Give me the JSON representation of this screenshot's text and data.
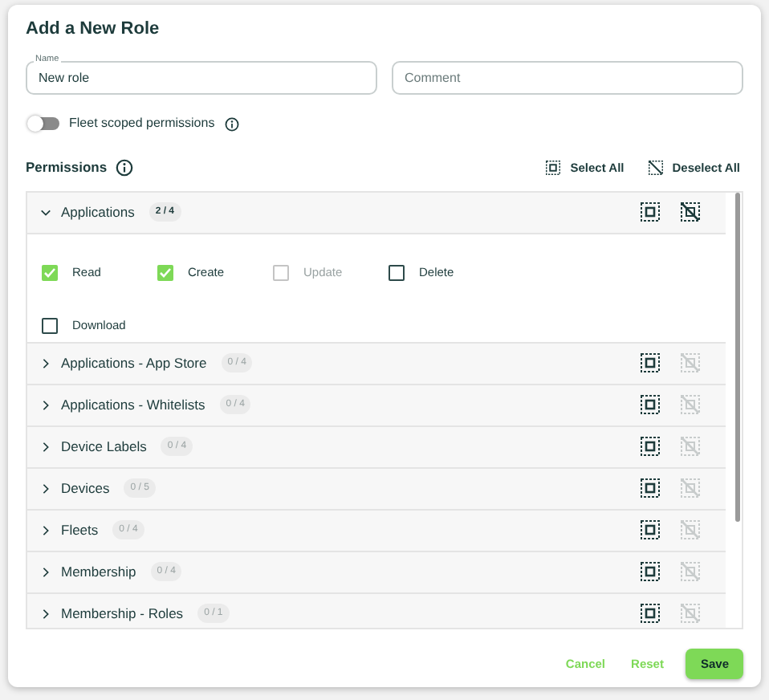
{
  "dialog": {
    "title": "Add a New Role"
  },
  "fields": [
    {
      "label": "Name",
      "value": "New role"
    },
    {
      "placeholder": "Comment"
    }
  ],
  "fleet_toggle": {
    "label": "Fleet scoped permissions",
    "on": false
  },
  "permissions": {
    "title": "Permissions",
    "select_all": "Select All",
    "deselect_all": "Deselect All",
    "groups": [
      {
        "name": "Applications",
        "count": "2 / 4",
        "expanded": true,
        "deselect_disabled": false,
        "options": [
          {
            "label": "Read",
            "checked": true,
            "disabled": false
          },
          {
            "label": "Create",
            "checked": true,
            "disabled": false
          },
          {
            "label": "Update",
            "checked": false,
            "disabled": true
          },
          {
            "label": "Delete",
            "checked": false,
            "disabled": false
          },
          {
            "label": "Download",
            "checked": false,
            "disabled": false
          }
        ]
      },
      {
        "name": "Applications - App Store",
        "count": "0 / 4",
        "expanded": false,
        "deselect_disabled": true
      },
      {
        "name": "Applications - Whitelists",
        "count": "0 / 4",
        "expanded": false,
        "deselect_disabled": true
      },
      {
        "name": "Device Labels",
        "count": "0 / 4",
        "expanded": false,
        "deselect_disabled": true
      },
      {
        "name": "Devices",
        "count": "0 / 5",
        "expanded": false,
        "deselect_disabled": true
      },
      {
        "name": "Fleets",
        "count": "0 / 4",
        "expanded": false,
        "deselect_disabled": true
      },
      {
        "name": "Membership",
        "count": "0 / 4",
        "expanded": false,
        "deselect_disabled": true
      },
      {
        "name": "Membership - Roles",
        "count": "0 / 1",
        "expanded": false,
        "deselect_disabled": true
      }
    ]
  },
  "buttons": {
    "cancel": "Cancel",
    "reset": "Reset",
    "save": "Save"
  }
}
